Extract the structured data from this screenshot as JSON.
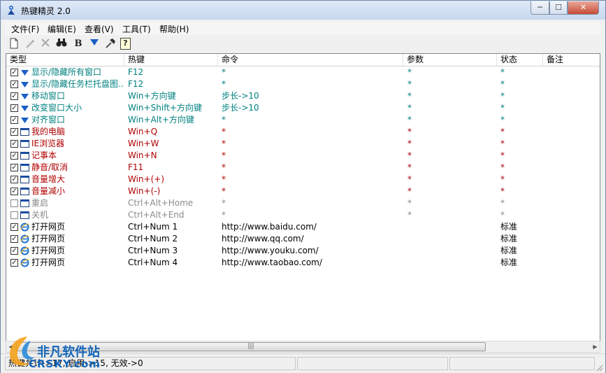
{
  "window": {
    "title": "热键精灵 2.0",
    "min_glyph": "─",
    "max_glyph": "☐",
    "close_glyph": "✕"
  },
  "menu": [
    "文件(F)",
    "编辑(E)",
    "查看(V)",
    "工具(T)",
    "帮助(H)"
  ],
  "toolbar": {
    "bold_label": "B",
    "help_label": "?"
  },
  "columns": [
    "类型",
    "热键",
    "命令",
    "参数",
    "状态",
    "备注"
  ],
  "rows": [
    {
      "icon": "blue-down-arrow-icon",
      "checked": true,
      "name": "显示/隐藏所有窗口",
      "hotkey": "F12",
      "command": "*",
      "param": "*",
      "status": "*",
      "note": "",
      "tone": "teal"
    },
    {
      "icon": "blue-down-arrow-icon",
      "checked": true,
      "name": "显示/隐藏任务栏托盘图..",
      "hotkey": "F12",
      "command": "*",
      "param": "*",
      "status": "*",
      "note": "",
      "tone": "teal"
    },
    {
      "icon": "blue-down-arrow-icon",
      "checked": true,
      "name": "移动窗口",
      "hotkey": "Win+方向键",
      "command": "步长->10",
      "param": "*",
      "status": "*",
      "note": "",
      "tone": "teal"
    },
    {
      "icon": "blue-down-arrow-icon",
      "checked": true,
      "name": "改变窗口大小",
      "hotkey": "Win+Shift+方向键",
      "command": "步长->10",
      "param": "*",
      "status": "*",
      "note": "",
      "tone": "teal"
    },
    {
      "icon": "blue-down-arrow-icon",
      "checked": true,
      "name": "对齐窗口",
      "hotkey": "Win+Alt+方向键",
      "command": "*",
      "param": "*",
      "status": "*",
      "note": "",
      "tone": "teal"
    },
    {
      "icon": "window-icon",
      "checked": true,
      "name": "我的电脑",
      "hotkey": "Win+Q",
      "command": "*",
      "param": "*",
      "status": "*",
      "note": "",
      "tone": "red"
    },
    {
      "icon": "window-icon",
      "checked": true,
      "name": "IE浏览器",
      "hotkey": "Win+W",
      "command": "*",
      "param": "*",
      "status": "*",
      "note": "",
      "tone": "red"
    },
    {
      "icon": "window-icon",
      "checked": true,
      "name": "记事本",
      "hotkey": "Win+N",
      "command": "*",
      "param": "*",
      "status": "*",
      "note": "",
      "tone": "red"
    },
    {
      "icon": "window-icon",
      "checked": true,
      "name": "静音/取消",
      "hotkey": "F11",
      "command": "*",
      "param": "*",
      "status": "*",
      "note": "",
      "tone": "red"
    },
    {
      "icon": "window-icon",
      "checked": true,
      "name": "音量增大",
      "hotkey": "Win+(+)",
      "command": "*",
      "param": "*",
      "status": "*",
      "note": "",
      "tone": "red"
    },
    {
      "icon": "window-icon",
      "checked": true,
      "name": "音量减小",
      "hotkey": "Win+(-)",
      "command": "*",
      "param": "*",
      "status": "*",
      "note": "",
      "tone": "red"
    },
    {
      "icon": "window-icon",
      "checked": false,
      "name": "重启",
      "hotkey": "Ctrl+Alt+Home",
      "command": "*",
      "param": "*",
      "status": "*",
      "note": "",
      "tone": "gray"
    },
    {
      "icon": "window-icon",
      "checked": false,
      "name": "关机",
      "hotkey": "Ctrl+Alt+End",
      "command": "*",
      "param": "*",
      "status": "*",
      "note": "",
      "tone": "gray"
    },
    {
      "icon": "ie-icon",
      "checked": true,
      "name": "打开网页",
      "hotkey": "Ctrl+Num 1",
      "command": "http://www.baidu.com/",
      "param": "",
      "status": "标准",
      "note": "",
      "tone": "blk"
    },
    {
      "icon": "ie-icon",
      "checked": true,
      "name": "打开网页",
      "hotkey": "Ctrl+Num 2",
      "command": "http://www.qq.com/",
      "param": "",
      "status": "标准",
      "note": "",
      "tone": "blk"
    },
    {
      "icon": "ie-icon",
      "checked": true,
      "name": "打开网页",
      "hotkey": "Ctrl+Num 3",
      "command": "http://www.youku.com/",
      "param": "",
      "status": "标准",
      "note": "",
      "tone": "blk"
    },
    {
      "icon": "ie-icon",
      "checked": true,
      "name": "打开网页",
      "hotkey": "Ctrl+Num 4",
      "command": "http://www.taobao.com/",
      "param": "",
      "status": "标准",
      "note": "",
      "tone": "blk"
    }
  ],
  "status": {
    "summary": "热键共计->17, 启用->15, 无效->0",
    "pane2": "",
    "pane3": ""
  },
  "watermark": {
    "title": "非凡软件站",
    "subtitle": "CRSKY.com"
  },
  "colors": {
    "teal": "#008080",
    "red": "#b00000",
    "gray": "#8a8a8a",
    "titlebar": "#dfe9f7"
  }
}
